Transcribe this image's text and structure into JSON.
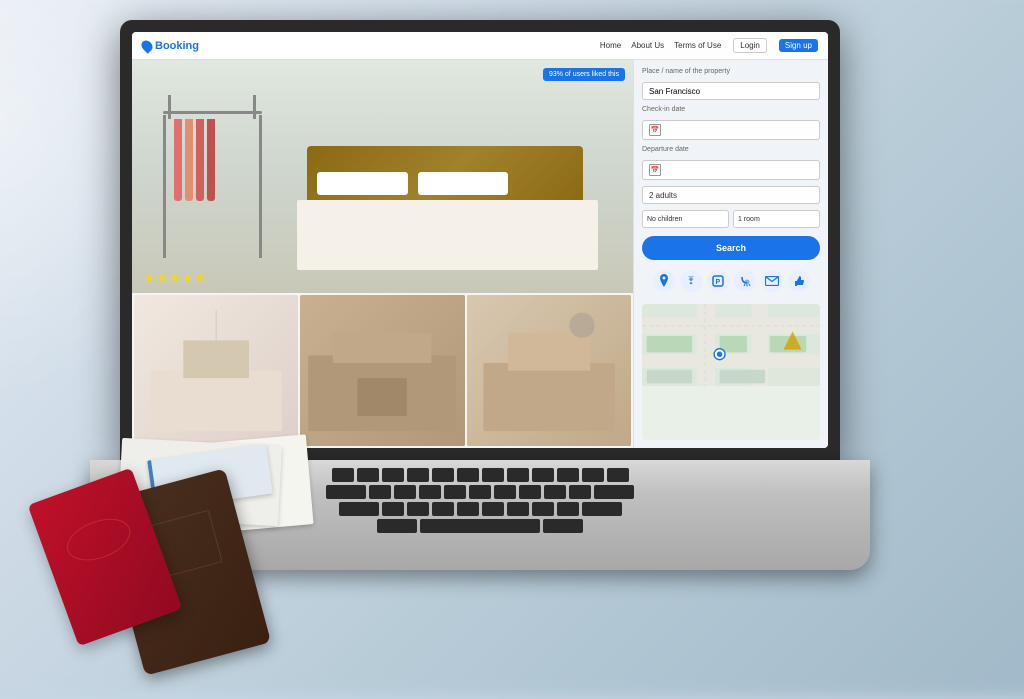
{
  "app": {
    "title": "Booking"
  },
  "navbar": {
    "logo": "Booking",
    "links": [
      "Home",
      "About Us",
      "Terms of Use"
    ],
    "login": "Login",
    "signup": "Sign up"
  },
  "hotel": {
    "liked_badge": "93% of users liked this",
    "stars": "★★★★★",
    "rating_count": "5"
  },
  "search_form": {
    "property_label": "Place / name of the property",
    "property_value": "San Francisco",
    "checkin_label": "Check-in date",
    "checkout_label": "Departure date",
    "guests_value": "2 adults",
    "children_value": "No children",
    "rooms_value": "1 room",
    "search_button": "Search"
  },
  "amenity_icons": [
    {
      "name": "location-icon",
      "symbol": "📍",
      "color": "#1a73e8"
    },
    {
      "name": "wifi-icon",
      "symbol": "📶",
      "color": "#1a73e8"
    },
    {
      "name": "parking-icon",
      "symbol": "🅿",
      "color": "#1a73e8"
    },
    {
      "name": "shower-icon",
      "symbol": "🚿",
      "color": "#1a73e8"
    },
    {
      "name": "email-icon",
      "symbol": "✉",
      "color": "#1a73e8"
    },
    {
      "name": "thumbsup-icon",
      "symbol": "👍",
      "color": "#1a73e8"
    }
  ],
  "colors": {
    "primary": "#1a73e8",
    "star": "#FFD700",
    "bg": "#f0f4f8",
    "dark": "#2a2a2a"
  },
  "thumbnails": [
    {
      "alt": "living room"
    },
    {
      "alt": "bedroom"
    },
    {
      "alt": "master bedroom"
    }
  ]
}
